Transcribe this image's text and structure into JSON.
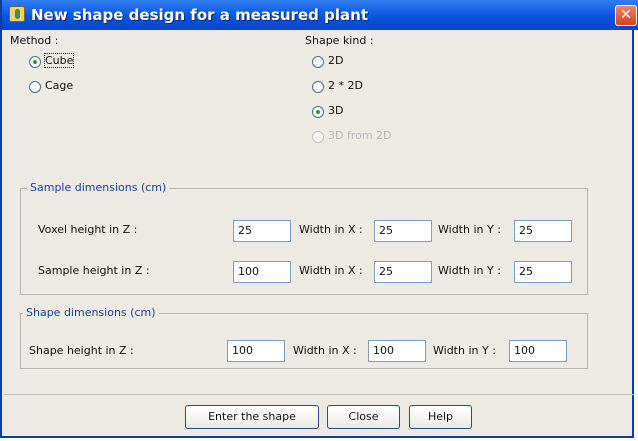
{
  "window": {
    "title": "New shape design for a measured plant",
    "close_glyph": "✕"
  },
  "method": {
    "label": "Method :",
    "options": [
      {
        "label": "Cube",
        "checked": true,
        "focused": true
      },
      {
        "label": "Cage",
        "checked": false
      }
    ]
  },
  "shape_kind": {
    "label": "Shape kind :",
    "options": [
      {
        "label": "2D",
        "checked": false,
        "enabled": true
      },
      {
        "label": "2 * 2D",
        "checked": false,
        "enabled": true
      },
      {
        "label": "3D",
        "checked": true,
        "enabled": true
      },
      {
        "label": "3D from 2D",
        "checked": false,
        "enabled": false
      }
    ]
  },
  "sample": {
    "title": "Sample dimensions (cm)",
    "voxel_label": "Voxel height in Z :",
    "voxel_value": "25",
    "voxel_wx_label": "Width in X :",
    "voxel_wx_value": "25",
    "voxel_wy_label": "Width in Y :",
    "voxel_wy_value": "25",
    "height_label": "Sample height in Z :",
    "height_value": "100",
    "height_wx_label": "Width in X :",
    "height_wx_value": "25",
    "height_wy_label": "Width in Y :",
    "height_wy_value": "25"
  },
  "shape": {
    "title": "Shape dimensions (cm)",
    "height_label": "Shape height in Z :",
    "height_value": "100",
    "wx_label": "Width in X :",
    "wx_value": "100",
    "wy_label": "Width in Y :",
    "wy_value": "100"
  },
  "buttons": {
    "enter": "Enter the shape",
    "close": "Close",
    "help": "Help"
  },
  "colors": {
    "titlebar": "#0a54de",
    "dialog_bg": "#eceae2",
    "group_title": "#1c3e9e",
    "radio_dot": "#2f9a2f"
  }
}
